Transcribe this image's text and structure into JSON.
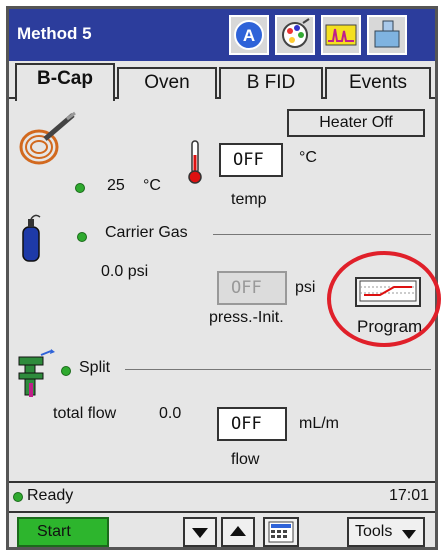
{
  "titlebar": {
    "title": "Method 5",
    "icons": [
      "instrument-a-icon",
      "colorwheel-icon",
      "chromatogram-icon",
      "sampler-icon"
    ]
  },
  "tabs": [
    {
      "label": "B-Cap",
      "active": true
    },
    {
      "label": "Oven",
      "active": false
    },
    {
      "label": "B FID",
      "active": false
    },
    {
      "label": "Events",
      "active": false
    }
  ],
  "heater": {
    "button_label": "Heater Off",
    "actual_value": "25",
    "actual_unit": "°C",
    "setpoint_value": "OFF",
    "setpoint_unit": "°C",
    "setpoint_label": "temp"
  },
  "carrier": {
    "label": "Carrier Gas",
    "actual_value": "0.0 psi",
    "setpoint_value": "OFF",
    "setpoint_unit": "psi",
    "setpoint_label": "press.-Init.",
    "program_label": "Program"
  },
  "split": {
    "label": "Split",
    "flow_label": "total flow",
    "flow_value": "0.0",
    "setpoint_value": "OFF",
    "setpoint_unit": "mL/m",
    "setpoint_label": "flow"
  },
  "status": {
    "text": "Ready",
    "time": "17:01",
    "status_color": "#2faa2f"
  },
  "bottom": {
    "start_label": "Start",
    "tools_label": "Tools"
  },
  "colors": {
    "titlebar": "#2c3d9c",
    "start": "#2db52d",
    "highlight": "#e0202a"
  }
}
